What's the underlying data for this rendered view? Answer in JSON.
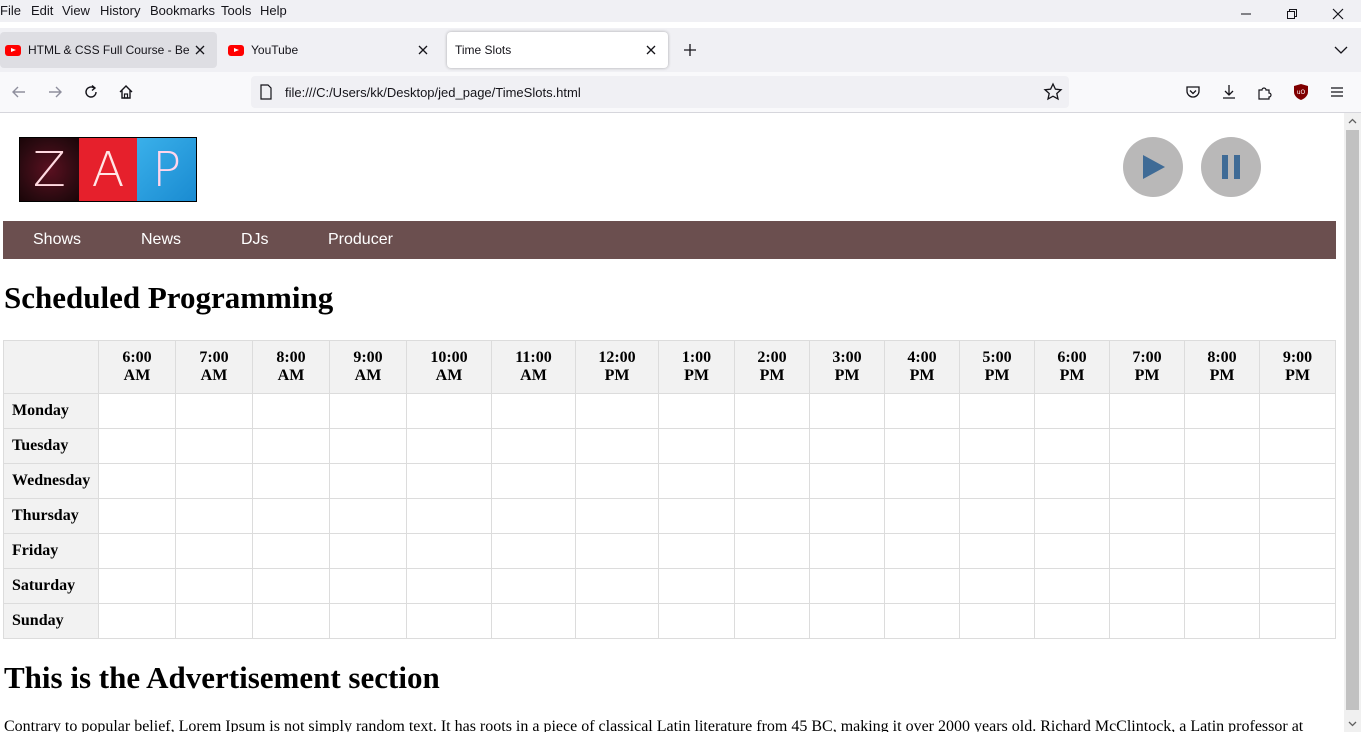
{
  "browser": {
    "menu": [
      "File",
      "Edit",
      "View",
      "History",
      "Bookmarks",
      "Tools",
      "Help"
    ],
    "tabs": [
      {
        "label": "HTML & CSS Full Course - Beginner to Pro",
        "favicon": "youtube-icon",
        "state": "inactive"
      },
      {
        "label": "YouTube",
        "favicon": "youtube-icon",
        "state": "inactive"
      },
      {
        "label": "Time Slots",
        "favicon": "none",
        "state": "active"
      }
    ],
    "url": "file:///C:/Users/kk/Desktop/jed_page/TimeSlots.html"
  },
  "site": {
    "logo_letters": [
      "Z",
      "A",
      "P"
    ],
    "nav": [
      "Shows",
      "News",
      "DJs",
      "Producer"
    ],
    "nav_color": "#6b4f4f",
    "media_controls": [
      "play-icon",
      "pause-icon"
    ]
  },
  "schedule": {
    "title": "Scheduled Programming",
    "times": [
      [
        "6:00",
        "AM"
      ],
      [
        "7:00",
        "AM"
      ],
      [
        "8:00",
        "AM"
      ],
      [
        "9:00",
        "AM"
      ],
      [
        "10:00",
        "AM"
      ],
      [
        "11:00",
        "AM"
      ],
      [
        "12:00",
        "PM"
      ],
      [
        "1:00",
        "PM"
      ],
      [
        "2:00",
        "PM"
      ],
      [
        "3:00",
        "PM"
      ],
      [
        "4:00",
        "PM"
      ],
      [
        "5:00",
        "PM"
      ],
      [
        "6:00",
        "PM"
      ],
      [
        "7:00",
        "PM"
      ],
      [
        "8:00",
        "PM"
      ],
      [
        "9:00",
        "PM"
      ]
    ],
    "days": [
      "Monday",
      "Tuesday",
      "Wednesday",
      "Thursday",
      "Friday",
      "Saturday",
      "Sunday"
    ]
  },
  "advertisement": {
    "title": "This is the Advertisement section",
    "text": "Contrary to popular belief, Lorem Ipsum is not simply random text. It has roots in a piece of classical Latin literature from 45 BC, making it over 2000 years old. Richard McClintock, a Latin professor at"
  }
}
